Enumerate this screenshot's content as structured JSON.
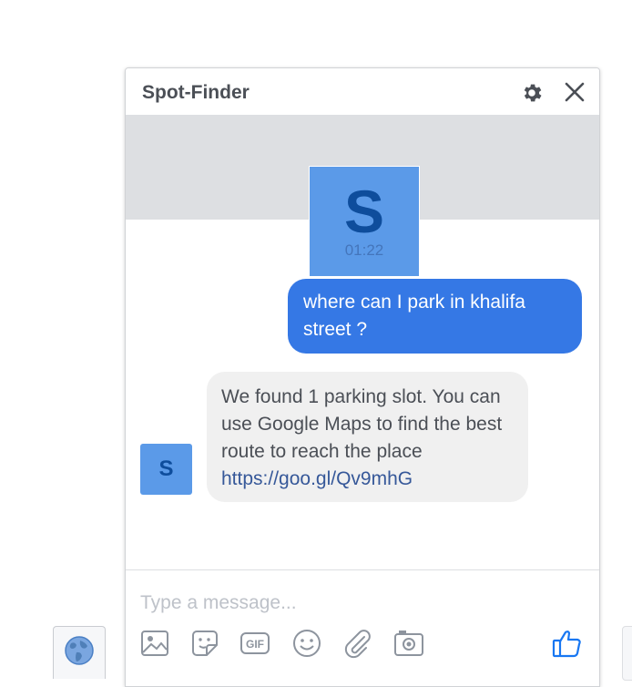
{
  "chat": {
    "title": "Spot-Finder",
    "page_avatar_letter": "S",
    "page_avatar_timestamp": "01:22",
    "messages": [
      {
        "from": "user",
        "text": "where can I park in khalifa street ?"
      },
      {
        "from": "bot",
        "text": "We found 1 parking slot. You can use Google Maps to find the best route to reach the place ",
        "link": "https://goo.gl/Qv9mhG"
      }
    ],
    "sender_avatar_letter": "S",
    "composer": {
      "placeholder": "Type a message...",
      "gif_label": "GIF"
    }
  },
  "colors": {
    "accent": "#3578e5",
    "link": "#365899",
    "incoming_bubble": "#f0f0f0",
    "avatar_bg": "#5b9ae8",
    "avatar_letter": "#0e4d9c",
    "like_icon": "#1877f2"
  },
  "icons": [
    "globe-icon",
    "gear-icon",
    "close-icon",
    "image-icon",
    "sticker-icon",
    "gif-icon",
    "emoji-icon",
    "attachment-icon",
    "camera-icon",
    "like-icon"
  ]
}
